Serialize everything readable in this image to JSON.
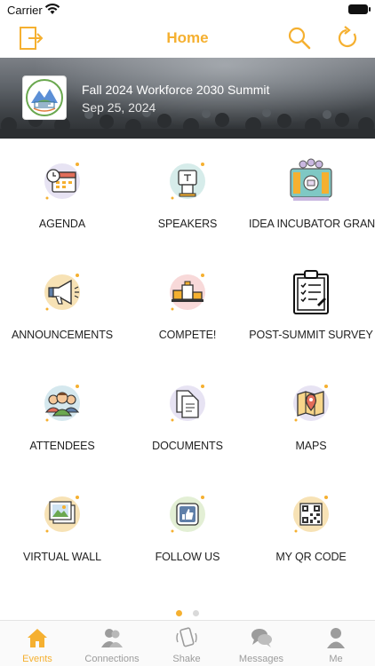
{
  "status_bar": {
    "carrier": "Carrier"
  },
  "nav": {
    "title": "Home"
  },
  "event": {
    "title": "Fall 2024 Workforce 2030 Summit",
    "date": "Sep 25, 2024"
  },
  "tiles": [
    {
      "label": "AGENDA",
      "icon": "calendar-clock-icon"
    },
    {
      "label": "SPEAKERS",
      "icon": "podium-icon"
    },
    {
      "label": "IDEA INCUBATOR GRANT",
      "icon": "group-presentation-icon"
    },
    {
      "label": "ANNOUNCEMENTS",
      "icon": "megaphone-icon"
    },
    {
      "label": "COMPETE!",
      "icon": "winner-podium-icon"
    },
    {
      "label": "POST-SUMMIT SURVEY",
      "icon": "clipboard-checklist-icon"
    },
    {
      "label": "ATTENDEES",
      "icon": "people-group-icon"
    },
    {
      "label": "DOCUMENTS",
      "icon": "documents-icon"
    },
    {
      "label": "MAPS",
      "icon": "map-pin-icon"
    },
    {
      "label": "VIRTUAL WALL",
      "icon": "photo-stack-icon"
    },
    {
      "label": "FOLLOW US",
      "icon": "thumbs-up-icon"
    },
    {
      "label": "MY QR CODE",
      "icon": "qr-code-icon"
    }
  ],
  "pager": {
    "pages": 2,
    "current": 1
  },
  "tabbar": [
    {
      "label": "Events",
      "icon": "home-icon",
      "active": true
    },
    {
      "label": "Connections",
      "icon": "connections-icon",
      "active": false
    },
    {
      "label": "Shake",
      "icon": "shake-phone-icon",
      "active": false
    },
    {
      "label": "Messages",
      "icon": "chat-bubbles-icon",
      "active": false
    },
    {
      "label": "Me",
      "icon": "person-icon",
      "active": false
    }
  ],
  "colors": {
    "accent": "#f5b030",
    "inactive": "#9c9c9c"
  }
}
